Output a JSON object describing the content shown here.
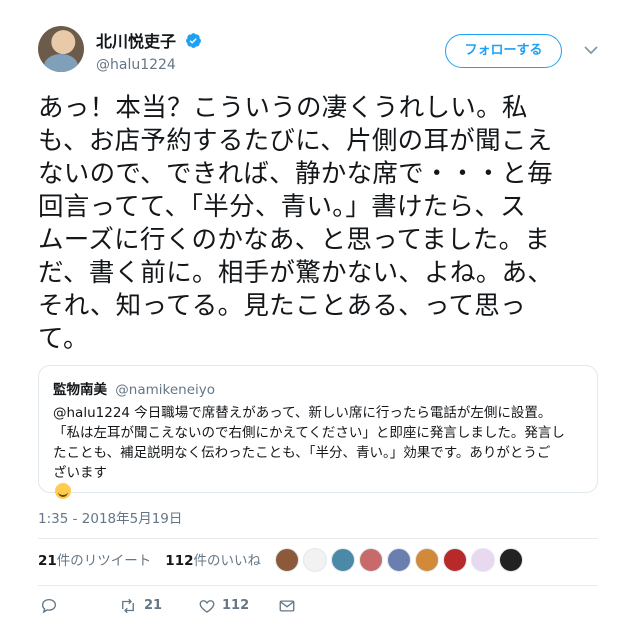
{
  "author": {
    "display_name": "北川悦吏子",
    "handle": "@halu1224",
    "verified": true,
    "avatar_icon": "avatar"
  },
  "follow_button": "フォローする",
  "more_icon": "chevron-down-icon",
  "tweet": {
    "lines": [
      "あっ！本当？こういうの凄くうれしい。私",
      "も、お店予約するたびに、片側の耳が聞こえ",
      "ないので、できれば、静かな席で・・・と毎",
      "回言ってて、「半分、青い。」書けたら、ス",
      "ムーズに行くのかなあ、と思ってました。ま",
      "だ、書く前に。相手が驚かない、よね。あ、",
      "それ、知ってる。見たことある、って思っ",
      "て。"
    ]
  },
  "quote": {
    "name": "監物南美",
    "handle": "@namikeneiyo",
    "lines": [
      "@halu1224 今日職場で席替えがあって、新しい席に行ったら電話が左側に設置。",
      "「私は左耳が聞こえないので右側にかえてください」と即座に発言しました。発言し",
      "たことも、補足説明なく伝わったことも、「半分、青い。」効果です。ありがとうご",
      "ざいます"
    ]
  },
  "timestamp": "1:35 - 2018年5月19日",
  "stats": {
    "retweets_num": "21",
    "retweets_label": "件のリツイート",
    "likes_num": "112",
    "likes_label": "件のいいね"
  },
  "likers": [
    "#8a5a3a",
    "#f2f2f2",
    "#4a8aa8",
    "#c86a6a",
    "#6a7fb0",
    "#d08a3a",
    "#b82a2a",
    "#e8d8f0",
    "#222222"
  ],
  "actions": {
    "reply_icon": "reply-icon",
    "retweet_count": "21",
    "like_count": "112",
    "dm_icon": "envelope-icon"
  },
  "colors": {
    "accent": "#1da1f2",
    "text": "#14171a",
    "muted": "#657786"
  }
}
